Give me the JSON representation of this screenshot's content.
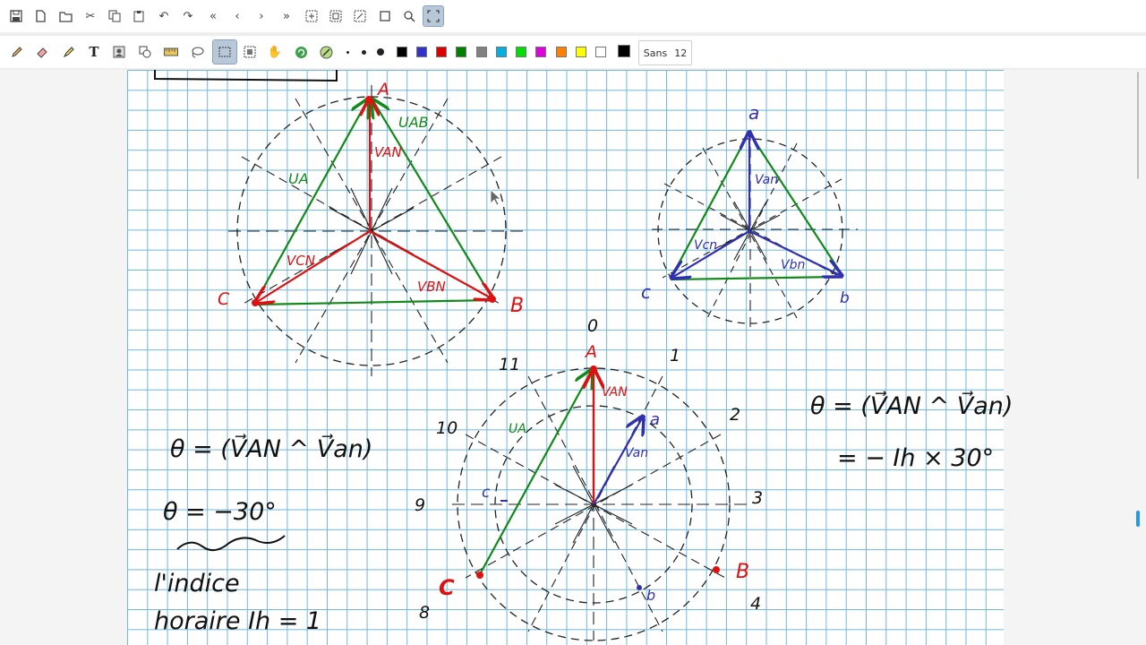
{
  "toolbar_top": {
    "items": [
      "save-icon",
      "new-page-icon",
      "open-icon",
      "cut-icon",
      "copy-icon",
      "paste-icon",
      "undo-icon",
      "redo-icon",
      "first-page-icon",
      "previous-page-icon",
      "next-page-icon",
      "last-page-icon",
      "select-all-icon",
      "select-rect-icon",
      "select-region-icon",
      "crop-icon",
      "zoom-icon",
      "fullscreen-icon"
    ]
  },
  "toolbar_tools": {
    "items": [
      "pencil-icon",
      "eraser-icon",
      "highlighter-icon",
      "text-icon",
      "image-icon",
      "shape-icon",
      "ruler-icon",
      "lasso-icon",
      "select-rect-tool-icon",
      "select-object-icon",
      "hand-icon",
      "refresh-icon",
      "fill-icon"
    ],
    "pen_sizes": [
      "small",
      "medium",
      "large"
    ],
    "colors": [
      "#000000",
      "#3333cc",
      "#dd0000",
      "#008000",
      "#808080",
      "#00b0e0",
      "#00e000",
      "#e000e0",
      "#ff8000",
      "#ffff00",
      "#ffffff",
      "#000000"
    ],
    "font_name": "Sans",
    "font_size": "12"
  },
  "canvas": {
    "labels": {
      "A_top": "A",
      "B_top": "B",
      "C_top": "C",
      "UAB": "UAB",
      "UA": "UA",
      "VAN": "VAN",
      "VCN": "VCN",
      "VBN": "VBN",
      "a_small": "a",
      "b_small": "b",
      "c_small": "c",
      "Van_small": "Van",
      "Vcn_small": "Vcn",
      "Vbn_small": "Vbn",
      "clock_0": "0",
      "clock_1": "1",
      "clock_2": "2",
      "clock_3": "3",
      "clock_4": "4",
      "clock_8": "8",
      "clock_9": "9",
      "clock_10": "10",
      "clock_11": "11",
      "A_clock": "A",
      "B_clock": "B",
      "C_clock": "C",
      "a_clock": "a",
      "b_clock": "b",
      "c_clock": "c",
      "VAN_clock": "VAN",
      "Van_clock": "Van",
      "UA_clock": "UA"
    },
    "formulas": {
      "theta_def_left": "θ = (V⃗AN ^ V⃗an)",
      "theta_value": "θ = −30°",
      "indice_line1": "l'indice",
      "indice_line2": "horaire Ih = 1",
      "theta_def_right": "θ = (V⃗AN ^ V⃗an)",
      "theta_general": "= − Ih × 30°"
    }
  }
}
